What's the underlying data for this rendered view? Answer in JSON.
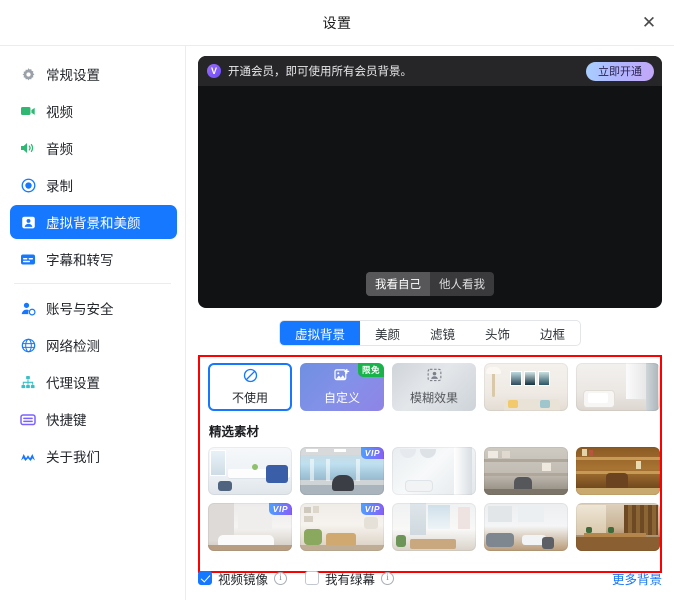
{
  "window": {
    "title": "设置",
    "close_label": "✕"
  },
  "colors": {
    "accent": "#1677ff",
    "annotation": "#ff0000",
    "free_badge": "#18b34a",
    "preview_bg": "#111214"
  },
  "sidebar": {
    "items": [
      {
        "label": "常规设置",
        "icon": "gear-icon",
        "color": "#9aa1a9",
        "active": false
      },
      {
        "label": "视频",
        "icon": "video-camera-icon",
        "color": "#2eb872",
        "active": false
      },
      {
        "label": "音频",
        "icon": "speaker-icon",
        "color": "#2eb872",
        "active": false
      },
      {
        "label": "录制",
        "icon": "record-circle-icon",
        "color": "#1677ff",
        "active": false
      },
      {
        "label": "虚拟背景和美颜",
        "icon": "person-frame-icon",
        "color": "#ffffff",
        "active": true
      },
      {
        "label": "字幕和转写",
        "icon": "caption-icon",
        "color": "#1677ff",
        "active": false
      },
      {
        "label": "账号与安全",
        "icon": "account-security-icon",
        "color": "#1677ff",
        "active": false
      },
      {
        "label": "网络检测",
        "icon": "globe-icon",
        "color": "#1677ff",
        "active": false
      },
      {
        "label": "代理设置",
        "icon": "proxy-node-icon",
        "color": "#39c0c6",
        "active": false
      },
      {
        "label": "快捷键",
        "icon": "keyboard-icon",
        "color": "#7b61ff",
        "active": false
      },
      {
        "label": "关于我们",
        "icon": "about-logo-icon",
        "color": "#1677ff",
        "active": false
      }
    ]
  },
  "preview": {
    "banner_text": "开通会员，即可使用所有会员背景。",
    "banner_badge": "V",
    "cta_label": "立即开通",
    "view_options": [
      {
        "label": "我看自己",
        "selected": true
      },
      {
        "label": "他人看我",
        "selected": false
      }
    ]
  },
  "tabs": [
    {
      "label": "虚拟背景",
      "active": true
    },
    {
      "label": "美颜",
      "active": false
    },
    {
      "label": "滤镜",
      "active": false
    },
    {
      "label": "头饰",
      "active": false
    },
    {
      "label": "边框",
      "active": false
    }
  ],
  "gallery": {
    "section_title": "精选素材",
    "row1": [
      {
        "kind": "none",
        "label": "不使用",
        "icon": "no-background-icon",
        "selected": true,
        "badge": ""
      },
      {
        "kind": "custom",
        "label": "自定义",
        "icon": "add-image-icon",
        "selected": false,
        "badge": "限免"
      },
      {
        "kind": "blur",
        "label": "模糊效果",
        "icon": "blur-person-icon",
        "selected": false,
        "badge": ""
      },
      {
        "kind": "photo",
        "label": "",
        "icon": "background-thumbnail",
        "selected": false,
        "badge": "",
        "scene": "living-room-art"
      },
      {
        "kind": "photo",
        "label": "",
        "icon": "background-thumbnail",
        "selected": false,
        "badge": "",
        "scene": "white-sofa-room"
      }
    ],
    "row2": [
      {
        "kind": "photo",
        "badge": "",
        "scene": "blue-meeting-room"
      },
      {
        "kind": "photo",
        "badge": "VIP",
        "scene": "city-window-office"
      },
      {
        "kind": "photo",
        "badge": "",
        "scene": "bright-white-studio"
      },
      {
        "kind": "photo",
        "badge": "",
        "scene": "wood-shelf-office"
      },
      {
        "kind": "photo",
        "badge": "",
        "scene": "warm-library"
      }
    ],
    "row3": [
      {
        "kind": "photo",
        "badge": "VIP",
        "scene": "grey-meeting-room"
      },
      {
        "kind": "photo",
        "badge": "VIP",
        "scene": "green-chair-room"
      },
      {
        "kind": "photo",
        "badge": "",
        "scene": "curtain-window-room"
      },
      {
        "kind": "photo",
        "badge": "",
        "scene": "modern-lounge"
      },
      {
        "kind": "photo",
        "badge": "",
        "scene": "wood-bar-room"
      }
    ]
  },
  "footer": {
    "mirror": {
      "label": "视频镜像",
      "checked": true,
      "info": "ⓘ"
    },
    "greenscreen": {
      "label": "我有绿幕",
      "checked": false,
      "info": "ⓘ"
    },
    "more_link": "更多背景",
    "info_glyph": "i"
  }
}
